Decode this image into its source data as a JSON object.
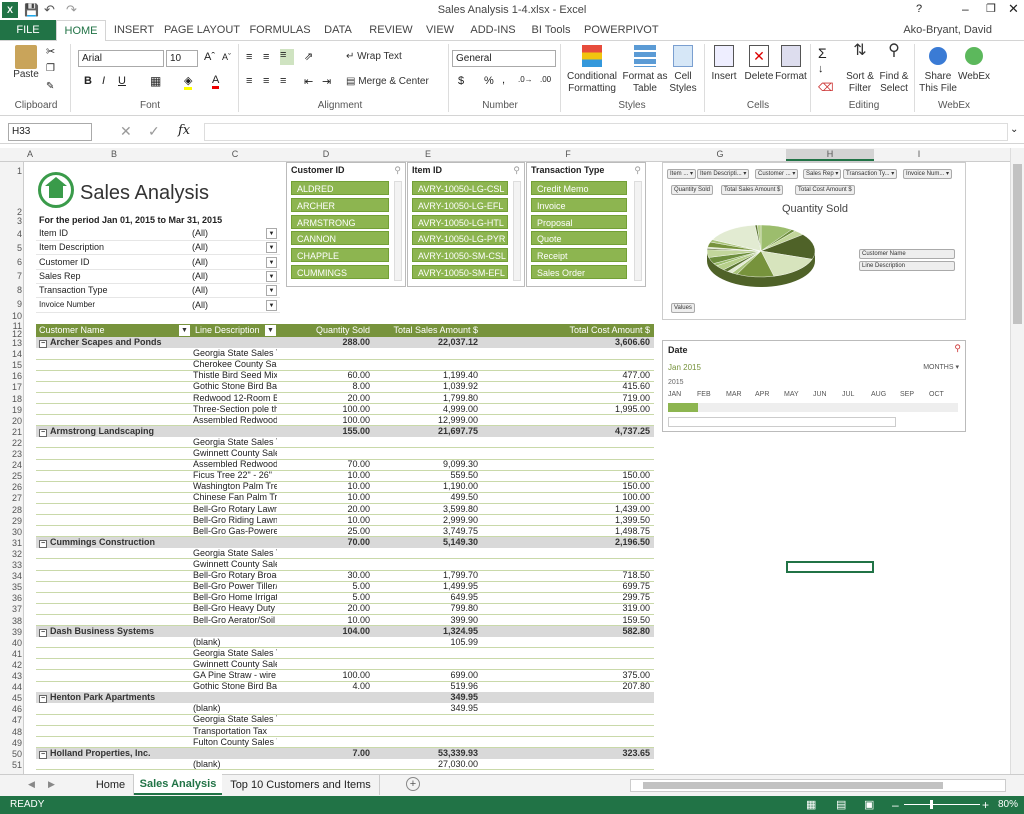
{
  "window": {
    "title": "Sales Analysis 1-4.xlsx - Excel",
    "user": "Ako-Bryant, David"
  },
  "ribbon": {
    "tabs": [
      "FILE",
      "HOME",
      "INSERT",
      "PAGE LAYOUT",
      "FORMULAS",
      "DATA",
      "REVIEW",
      "VIEW",
      "ADD-INS",
      "BI Tools",
      "POWERPIVOT"
    ],
    "font_name": "Arial",
    "font_size": "10",
    "number_format": "General",
    "groups": [
      "Clipboard",
      "Font",
      "Alignment",
      "Number",
      "Styles",
      "Cells",
      "Editing",
      "WebEx"
    ],
    "buttons": {
      "paste": "Paste",
      "wrap": "Wrap Text",
      "merge": "Merge & Center",
      "cond1": "Conditional",
      "cond2": "Formatting",
      "fmt1": "Format as",
      "fmt2": "Table",
      "cs1": "Cell",
      "cs2": "Styles",
      "insert": "Insert",
      "delete": "Delete",
      "format": "Format",
      "sort1": "Sort &",
      "sort2": "Filter",
      "find1": "Find &",
      "find2": "Select",
      "share1": "Share",
      "share2": "This File",
      "webex": "WebEx"
    }
  },
  "formula_bar": {
    "name_box": "H33",
    "formula": ""
  },
  "columns": [
    "A",
    "B",
    "C",
    "D",
    "E",
    "F",
    "G",
    "H",
    "I"
  ],
  "report": {
    "title": "Sales Analysis",
    "period": "For the period Jan 01, 2015 to Mar 31, 2015",
    "filters": [
      {
        "label": "Item ID",
        "value": "(All)"
      },
      {
        "label": "Item Description",
        "value": "(All)"
      },
      {
        "label": "Customer ID",
        "value": "(All)"
      },
      {
        "label": "Sales Rep",
        "value": "(All)"
      },
      {
        "label": "Transaction Type",
        "value": "(All)"
      },
      {
        "label": "Invoice Number",
        "value": "(All)"
      }
    ],
    "headers": [
      "Customer Name",
      "Line Description",
      "Quantity Sold",
      "Total Sales Amount $",
      "Total Cost Amount $"
    ]
  },
  "slicers": {
    "customer": {
      "title": "Customer ID",
      "items": [
        "ALDRED",
        "ARCHER",
        "ARMSTRONG",
        "CANNON",
        "CHAPPLE",
        "CUMMINGS"
      ]
    },
    "item": {
      "title": "Item ID",
      "items": [
        "AVRY-10050-LG-CSL",
        "AVRY-10050-LG-EFL",
        "AVRY-10050-LG-HTL",
        "AVRY-10050-LG-PYR",
        "AVRY-10050-SM-CSL",
        "AVRY-10050-SM-EFL"
      ]
    },
    "transaction": {
      "title": "Transaction Type",
      "items": [
        "Credit Memo",
        "Invoice",
        "Proposal",
        "Quote",
        "Receipt",
        "Sales Order"
      ]
    }
  },
  "pivot_chart": {
    "title": "Quantity Sold",
    "field_buttons": [
      "Item ...",
      "Item Descripti...",
      "Customer ...",
      "Sales Rep",
      "Transaction Ty...",
      "Invoice Num..."
    ],
    "value_buttons": [
      "Quantity Sold",
      "Total Sales Amount $",
      "Total Cost Amount $"
    ],
    "legend_fields": [
      "Customer Name",
      "Line Description"
    ],
    "values_label": "Values"
  },
  "chart_data": {
    "type": "pie",
    "title": "Quantity Sold",
    "values": [
      60,
      8,
      20,
      100,
      100,
      70,
      10,
      10,
      10,
      20,
      10,
      25,
      30,
      5,
      5,
      20,
      10,
      100,
      4,
      7
    ]
  },
  "timeline": {
    "title": "Date",
    "period": "Jan 2015",
    "unit": "MONTHS",
    "year": "2015",
    "months": [
      "JAN",
      "FEB",
      "MAR",
      "APR",
      "MAY",
      "JUN",
      "JUL",
      "AUG",
      "SEP",
      "OCT"
    ]
  },
  "rows": [
    {
      "n": "13",
      "type": "group",
      "name": "Archer Scapes and Ponds",
      "qty": "288.00",
      "sales": "22,037.12",
      "cost": "3,606.60"
    },
    {
      "n": "14",
      "desc": "Georgia State Sales Ta",
      "qty": "",
      "sales": "",
      "cost": ""
    },
    {
      "n": "15",
      "desc": "Cherokee County Sale",
      "qty": "",
      "sales": "",
      "cost": ""
    },
    {
      "n": "16",
      "desc": "Thistle Bird Seed Mix 6",
      "qty": "60.00",
      "sales": "1,199.40",
      "cost": "477.00"
    },
    {
      "n": "17",
      "desc": "Gothic Stone Bird Bath",
      "qty": "8.00",
      "sales": "1,039.92",
      "cost": "415.60"
    },
    {
      "n": "18",
      "desc": "Redwood 12-Room Bir",
      "qty": "20.00",
      "sales": "1,799.80",
      "cost": "719.00"
    },
    {
      "n": "19",
      "desc": "Three-Section pole tha",
      "qty": "100.00",
      "sales": "4,999.00",
      "cost": "1,995.00"
    },
    {
      "n": "20",
      "desc": "Assembled Redwood",
      "qty": "100.00",
      "sales": "12,999.00",
      "cost": ""
    },
    {
      "n": "21",
      "type": "group",
      "name": "Armstrong Landscaping",
      "qty": "155.00",
      "sales": "21,697.75",
      "cost": "4,737.25"
    },
    {
      "n": "22",
      "desc": "Georgia State Sales Ta",
      "qty": "",
      "sales": "",
      "cost": ""
    },
    {
      "n": "23",
      "desc": "Gwinnett County Sale",
      "qty": "",
      "sales": "",
      "cost": ""
    },
    {
      "n": "24",
      "desc": "Assembled Redwood",
      "qty": "70.00",
      "sales": "9,099.30",
      "cost": ""
    },
    {
      "n": "25",
      "desc": "Ficus Tree 22\" - 26\"",
      "qty": "10.00",
      "sales": "559.50",
      "cost": "150.00"
    },
    {
      "n": "26",
      "desc": "Washington Palm Tree",
      "qty": "10.00",
      "sales": "1,190.00",
      "cost": "150.00"
    },
    {
      "n": "27",
      "desc": "Chinese Fan Palm Tree",
      "qty": "10.00",
      "sales": "499.50",
      "cost": "100.00"
    },
    {
      "n": "28",
      "desc": "Bell-Gro Rotary Lawn",
      "qty": "20.00",
      "sales": "3,599.80",
      "cost": "1,439.00"
    },
    {
      "n": "29",
      "desc": "Bell-Gro Riding Lawn I",
      "qty": "10.00",
      "sales": "2,999.90",
      "cost": "1,399.50"
    },
    {
      "n": "30",
      "desc": "Bell-Gro Gas-Powered",
      "qty": "25.00",
      "sales": "3,749.75",
      "cost": "1,498.75"
    },
    {
      "n": "31",
      "type": "group",
      "name": "Cummings Construction",
      "qty": "70.00",
      "sales": "5,149.30",
      "cost": "2,196.50"
    },
    {
      "n": "32",
      "desc": "Georgia State Sales Ta",
      "qty": "",
      "sales": "",
      "cost": ""
    },
    {
      "n": "33",
      "desc": "Gwinnett County Sale",
      "qty": "",
      "sales": "",
      "cost": ""
    },
    {
      "n": "34",
      "desc": "Bell-Gro Rotary Broad",
      "qty": "30.00",
      "sales": "1,799.70",
      "cost": "718.50"
    },
    {
      "n": "35",
      "desc": "Bell-Gro Power Tiller/C",
      "qty": "5.00",
      "sales": "1,499.95",
      "cost": "699.75"
    },
    {
      "n": "36",
      "desc": "Bell-Gro Home Irrigatio",
      "qty": "5.00",
      "sales": "649.95",
      "cost": "299.75"
    },
    {
      "n": "37",
      "desc": "Bell-Gro Heavy Duty G",
      "qty": "20.00",
      "sales": "799.80",
      "cost": "319.00"
    },
    {
      "n": "38",
      "desc": "Bell-Gro Aerator/Soil D",
      "qty": "10.00",
      "sales": "399.90",
      "cost": "159.50"
    },
    {
      "n": "39",
      "type": "group",
      "name": "Dash Business Systems",
      "qty": "104.00",
      "sales": "1,324.95",
      "cost": "582.80"
    },
    {
      "n": "40",
      "desc": "(blank)",
      "qty": "",
      "sales": "105.99",
      "cost": ""
    },
    {
      "n": "41",
      "desc": "Georgia State Sales Ta",
      "qty": "",
      "sales": "",
      "cost": ""
    },
    {
      "n": "42",
      "desc": "Gwinnett County Sale",
      "qty": "",
      "sales": "",
      "cost": ""
    },
    {
      "n": "43",
      "desc": "GA Pine Straw - wire",
      "qty": "100.00",
      "sales": "699.00",
      "cost": "375.00"
    },
    {
      "n": "44",
      "desc": "Gothic Stone Bird Bath",
      "qty": "4.00",
      "sales": "519.96",
      "cost": "207.80"
    },
    {
      "n": "45",
      "type": "group",
      "name": "Henton Park Apartments",
      "qty": "",
      "sales": "349.95",
      "cost": ""
    },
    {
      "n": "46",
      "desc": "(blank)",
      "qty": "",
      "sales": "349.95",
      "cost": ""
    },
    {
      "n": "47",
      "desc": "Georgia State Sales Ta",
      "qty": "",
      "sales": "",
      "cost": ""
    },
    {
      "n": "48",
      "desc": "Transportation Tax",
      "qty": "",
      "sales": "",
      "cost": ""
    },
    {
      "n": "49",
      "desc": "Fulton County Sales Ta",
      "qty": "",
      "sales": "",
      "cost": ""
    },
    {
      "n": "50",
      "type": "group",
      "name": "Holland Properties, Inc.",
      "qty": "7.00",
      "sales": "53,339.93",
      "cost": "323.65"
    },
    {
      "n": "51",
      "desc": "(blank)",
      "qty": "",
      "sales": "27,030.00",
      "cost": ""
    }
  ],
  "sheet_tabs": [
    "Home",
    "Sales Analysis",
    "Top 10 Customers and Items"
  ],
  "status": {
    "text": "READY",
    "zoom": "80%"
  }
}
